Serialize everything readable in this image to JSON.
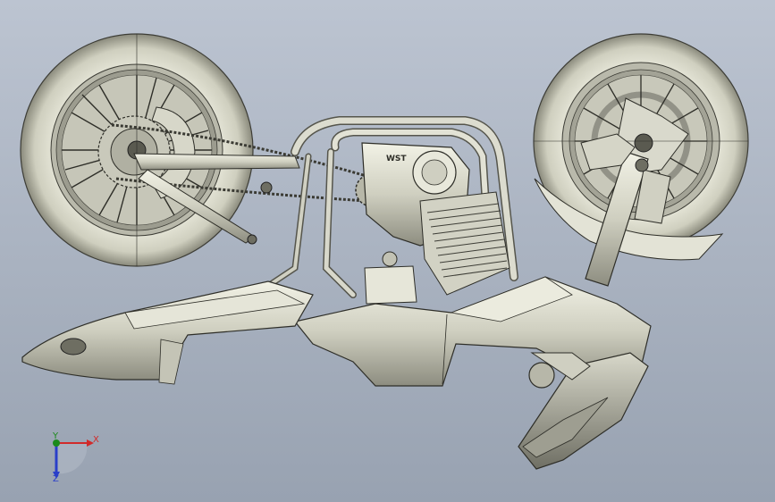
{
  "viewport": {
    "background_top": "#bcc4d1",
    "background_bottom": "#98a2b1"
  },
  "model": {
    "engine_badge": "WST"
  },
  "triad": {
    "x_label": "X",
    "y_label": "Y",
    "z_label": "Z",
    "x_color": "#d12a2a",
    "y_color": "#1b8a1b",
    "z_color": "#2a3fc9"
  }
}
